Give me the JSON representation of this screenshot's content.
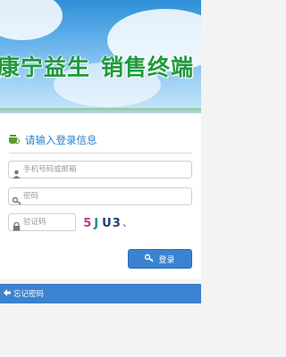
{
  "banner": {
    "title_left": "康宁益生",
    "title_right": "销售终端"
  },
  "login": {
    "heading": "请输入登录信息",
    "account_placeholder": "手机号码或邮箱",
    "password_placeholder": "密码",
    "captcha_placeholder": "验证码",
    "captcha_text": [
      "5",
      "J",
      "U3"
    ],
    "captcha_colors": [
      "#c03a8a",
      "#1c8a8a",
      "#1a3f7a"
    ],
    "login_label": "登录"
  },
  "footer": {
    "forgot_label": "忘记密码"
  },
  "colors": {
    "accent": "#3b82d0",
    "brand_green": "#1f9a3c"
  }
}
